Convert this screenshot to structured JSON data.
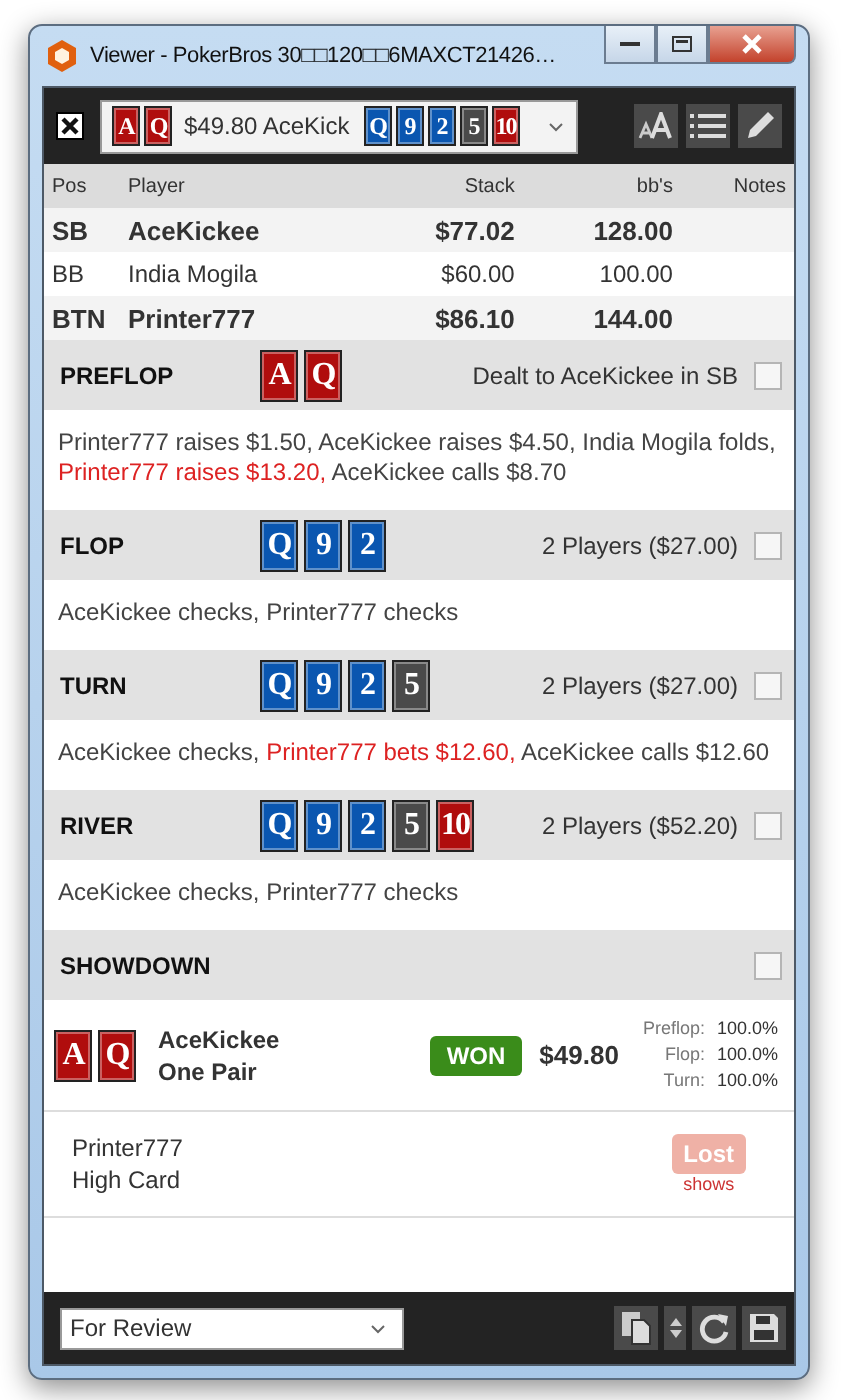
{
  "window": {
    "title": "Viewer - PokerBros 30□□120□□6MAXCT21426…"
  },
  "hand_selector": {
    "hole_cards": [
      {
        "rank": "A",
        "color": "#b00d0d"
      },
      {
        "rank": "Q",
        "color": "#b00d0d"
      }
    ],
    "text": "$49.80 AceKick",
    "board": [
      {
        "rank": "Q",
        "color": "#0a56b0"
      },
      {
        "rank": "9",
        "color": "#0a56b0"
      },
      {
        "rank": "2",
        "color": "#0a56b0"
      },
      {
        "rank": "5",
        "color": "#4a4a4a"
      },
      {
        "rank": "10",
        "color": "#b00d0d"
      }
    ]
  },
  "players_table": {
    "columns": [
      "Pos",
      "Player",
      "Stack",
      "bb's",
      "Notes"
    ],
    "rows": [
      {
        "pos": "SB",
        "player": "AceKickee",
        "stack": "$77.02",
        "bbs": "128.00",
        "bold": true
      },
      {
        "pos": "BB",
        "player": "India Mogila",
        "stack": "$60.00",
        "bbs": "100.00",
        "bold": false
      },
      {
        "pos": "BTN",
        "player": "Printer777",
        "stack": "$86.10",
        "bbs": "144.00",
        "bold": true
      }
    ]
  },
  "streets": [
    {
      "name": "PREFLOP",
      "cards": [
        {
          "rank": "A",
          "color": "#b00d0d"
        },
        {
          "rank": "Q",
          "color": "#b00d0d"
        }
      ],
      "info": "Dealt to AceKickee in SB",
      "checked": false,
      "actions": [
        {
          "text": "Printer777 raises $1.50,",
          "highlight": false
        },
        {
          "text": "AceKickee raises $4.50,",
          "highlight": false
        },
        {
          "text": "India Mogila folds,",
          "highlight": false
        },
        {
          "text": "Printer777 raises $13.20,",
          "highlight": true
        },
        {
          "text": "AceKickee calls $8.70",
          "highlight": false
        }
      ]
    },
    {
      "name": "FLOP",
      "cards": [
        {
          "rank": "Q",
          "color": "#0a56b0"
        },
        {
          "rank": "9",
          "color": "#0a56b0"
        },
        {
          "rank": "2",
          "color": "#0a56b0"
        }
      ],
      "info": "2 Players ($27.00)",
      "checked": false,
      "actions": [
        {
          "text": "AceKickee checks,",
          "highlight": false
        },
        {
          "text": "Printer777 checks",
          "highlight": false
        }
      ]
    },
    {
      "name": "TURN",
      "cards": [
        {
          "rank": "Q",
          "color": "#0a56b0"
        },
        {
          "rank": "9",
          "color": "#0a56b0"
        },
        {
          "rank": "2",
          "color": "#0a56b0"
        },
        {
          "rank": "5",
          "color": "#4a4a4a"
        }
      ],
      "info": "2 Players ($27.00)",
      "checked": false,
      "actions": [
        {
          "text": "AceKickee checks,",
          "highlight": false
        },
        {
          "text": "Printer777 bets $12.60,",
          "highlight": true
        },
        {
          "text": "AceKickee calls $12.60",
          "highlight": false
        }
      ]
    },
    {
      "name": "RIVER",
      "cards": [
        {
          "rank": "Q",
          "color": "#0a56b0"
        },
        {
          "rank": "9",
          "color": "#0a56b0"
        },
        {
          "rank": "2",
          "color": "#0a56b0"
        },
        {
          "rank": "5",
          "color": "#4a4a4a"
        },
        {
          "rank": "10",
          "color": "#b00d0d"
        }
      ],
      "info": "2 Players ($52.20)",
      "checked": false,
      "actions": [
        {
          "text": "AceKickee checks,",
          "highlight": false
        },
        {
          "text": "Printer777 checks",
          "highlight": false
        }
      ]
    }
  ],
  "showdown": {
    "title": "SHOWDOWN",
    "checked": false,
    "players": [
      {
        "kind": "won",
        "cards": [
          {
            "rank": "A",
            "color": "#b00d0d"
          },
          {
            "rank": "Q",
            "color": "#b00d0d"
          }
        ],
        "name": "AceKickee",
        "hand": "One Pair",
        "result": "WON",
        "amount": "$49.80",
        "equity": [
          {
            "label": "Preflop:",
            "value": "100.0%"
          },
          {
            "label": "Flop:",
            "value": "100.0%"
          },
          {
            "label": "Turn:",
            "value": "100.0%"
          }
        ]
      },
      {
        "kind": "lost",
        "name": "Printer777",
        "hand": "High Card",
        "result": "Lost",
        "note": "shows"
      }
    ]
  },
  "footer": {
    "status_select": "For Review"
  }
}
